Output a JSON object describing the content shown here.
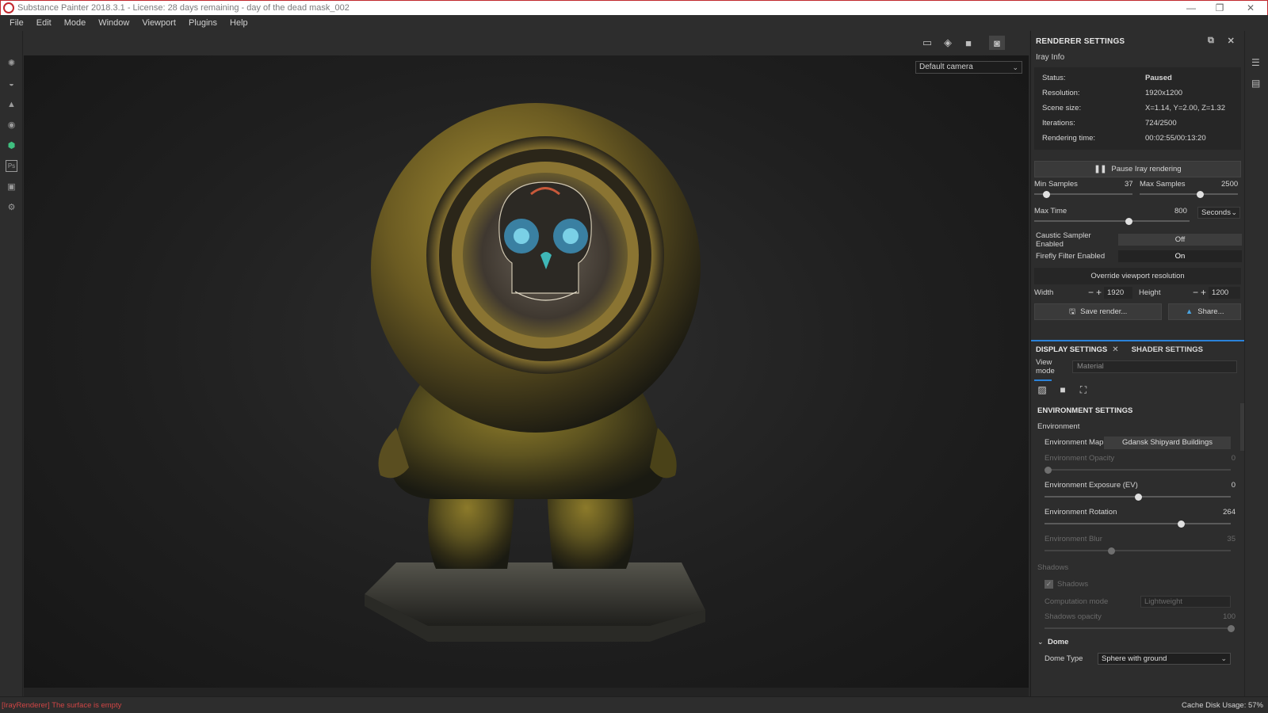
{
  "window": {
    "title": "Substance Painter 2018.3.1 - License: 28 days remaining - day of the dead mask_002",
    "minimize": "—",
    "restore": "❐",
    "close": "✕"
  },
  "menu": [
    "File",
    "Edit",
    "Mode",
    "Window",
    "Viewport",
    "Plugins",
    "Help"
  ],
  "viewport": {
    "camera": "Default camera"
  },
  "renderer": {
    "title": "RENDERER SETTINGS",
    "section": "Iray Info",
    "info": [
      {
        "k": "Status:",
        "v": "Paused"
      },
      {
        "k": "Resolution:",
        "v": "1920x1200"
      },
      {
        "k": "Scene size:",
        "v": "X=1.14, Y=2.00, Z=1.32"
      },
      {
        "k": "Iterations:",
        "v": "724/2500"
      },
      {
        "k": "Rendering time:",
        "v": "00:02:55/00:13:20"
      }
    ],
    "pause_label": "Pause Iray rendering",
    "min_samples": {
      "label": "Min Samples",
      "value": "37"
    },
    "max_samples": {
      "label": "Max Samples",
      "value": "2500"
    },
    "max_time": {
      "label": "Max Time",
      "value": "800",
      "unit": "Seconds"
    },
    "caustic": {
      "label": "Caustic Sampler Enabled",
      "value": "Off"
    },
    "firefly": {
      "label": "Firefly Filter Enabled",
      "value": "On"
    },
    "override_label": "Override viewport resolution",
    "width": {
      "label": "Width",
      "value": "1920"
    },
    "height": {
      "label": "Height",
      "value": "1200"
    },
    "save_label": "Save render...",
    "share_label": "Share..."
  },
  "tabs": {
    "display": "DISPLAY SETTINGS",
    "shader": "SHADER SETTINGS"
  },
  "view_mode": {
    "label": "View mode",
    "value": "Material"
  },
  "environment": {
    "title": "ENVIRONMENT SETTINGS",
    "group": "Environment",
    "map": {
      "label": "Environment Map",
      "value": "Gdansk Shipyard Buildings"
    },
    "opacity": {
      "label": "Environment Opacity",
      "value": "0"
    },
    "exposure": {
      "label": "Environment Exposure (EV)",
      "value": "0"
    },
    "rotation": {
      "label": "Environment Rotation",
      "value": "264"
    },
    "blur": {
      "label": "Environment Blur",
      "value": "35"
    },
    "shadows_group": "Shadows",
    "shadows_check": "Shadows",
    "computation": {
      "label": "Computation mode",
      "value": "Lightweight"
    },
    "shadows_opacity": {
      "label": "Shadows opacity",
      "value": "100"
    },
    "dome_group": "Dome",
    "dome_type": {
      "label": "Dome Type",
      "value": "Sphere with ground"
    }
  },
  "status": {
    "error": "[IrayRenderer] The surface is empty",
    "cache": "Cache Disk Usage:   57%"
  }
}
